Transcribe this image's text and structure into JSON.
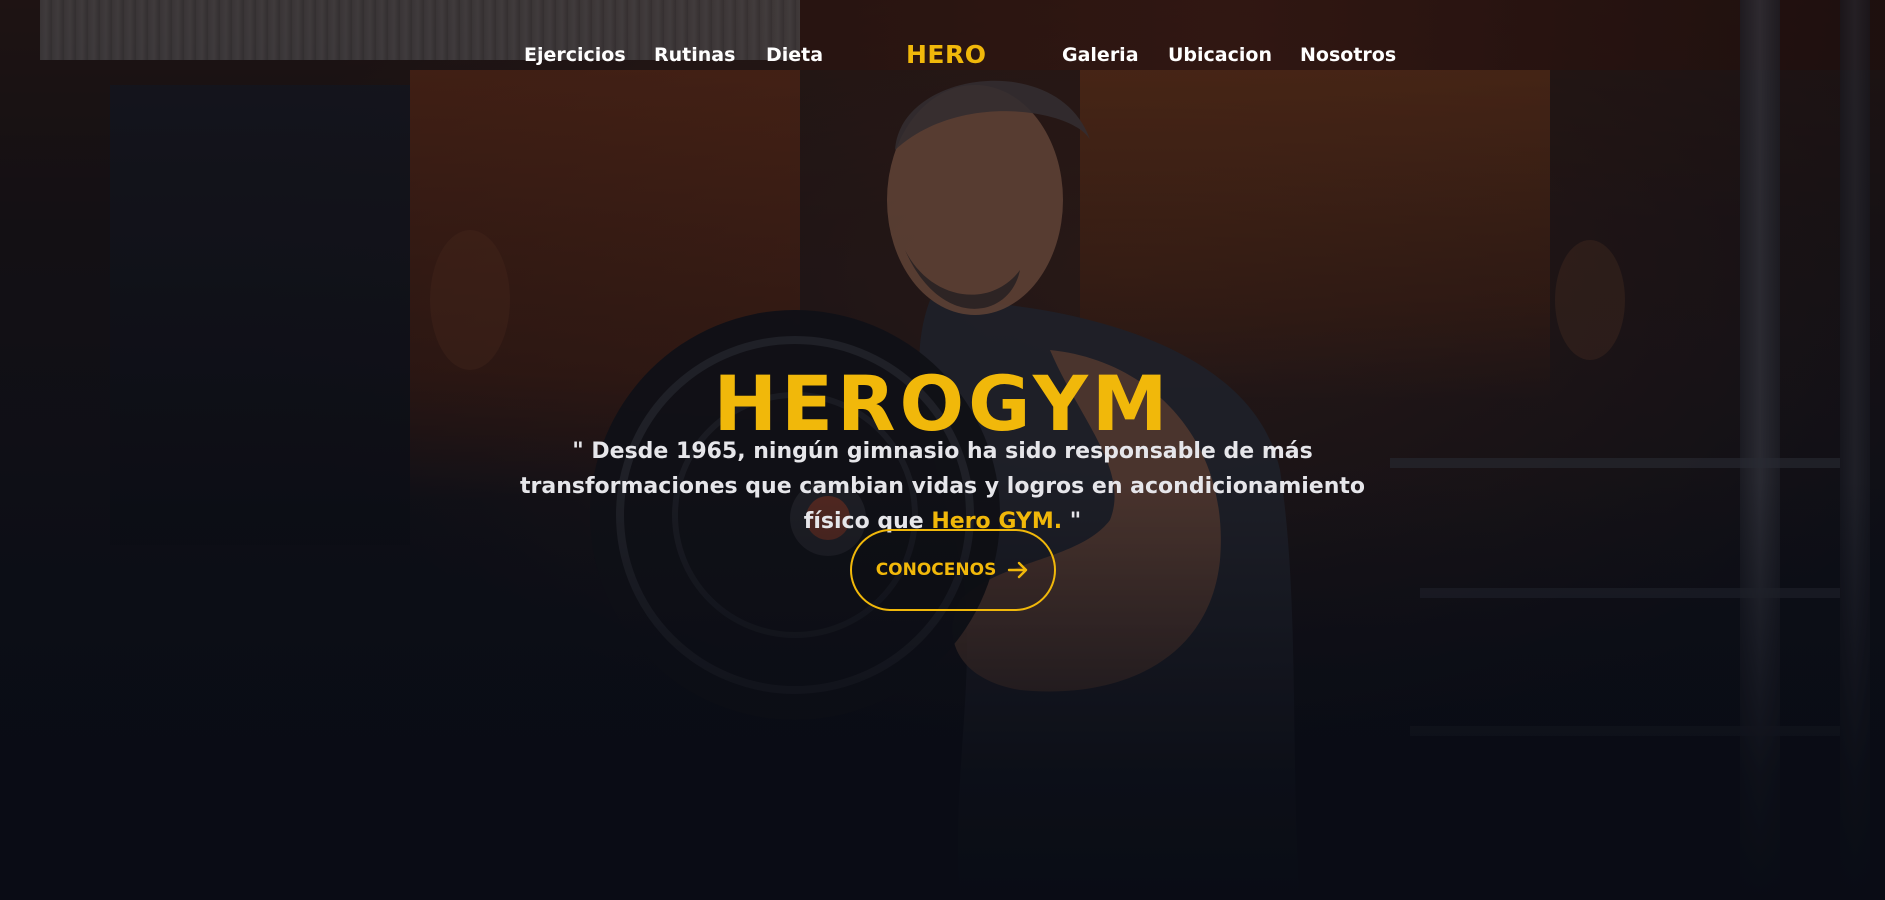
{
  "nav": {
    "left_items": [
      {
        "label": "Ejercicios"
      },
      {
        "label": "Rutinas"
      },
      {
        "label": "Dieta"
      }
    ],
    "logo": "HERO",
    "right_items": [
      {
        "label": "Galeria"
      },
      {
        "label": "Ubicacion"
      },
      {
        "label": "Nosotros"
      }
    ]
  },
  "hero": {
    "title": "HEROGYM",
    "quote_prefix": "\" Desde 1965, ningún gimnasio ha sido responsable de más transformaciones que cambian vidas y logros en acondicionamiento físico que ",
    "quote_highlight": "Hero GYM.",
    "quote_suffix": " \"",
    "cta_label": "CONOCENOS",
    "cta_icon": "arrow-right-icon"
  },
  "colors": {
    "accent": "#f1b80a",
    "text": "#ffffff",
    "background": "#0b0f18"
  }
}
